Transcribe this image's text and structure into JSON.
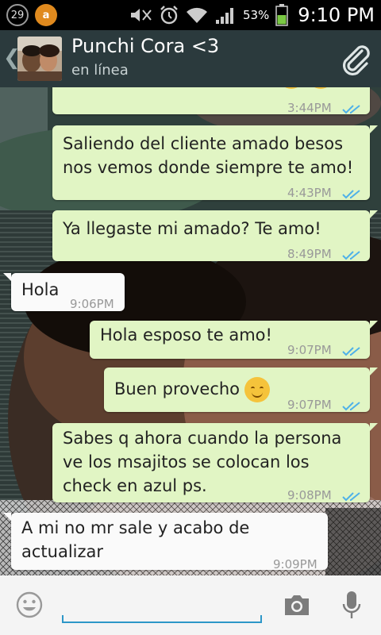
{
  "status": {
    "notif_count": "29",
    "notif_app": "a",
    "battery": "53%",
    "time": "9:10 PM"
  },
  "contact": {
    "name": "Punchi Cora <3",
    "status": "en línea"
  },
  "messages": [
    {
      "text": "",
      "time": "3:44PM"
    },
    {
      "text": "Saliendo del cliente amado besos\nnos vemos donde siempre te amo!",
      "time": "4:43PM"
    },
    {
      "text": "Ya llegaste mi amado? Te amo!",
      "time": "8:49PM"
    },
    {
      "text": "Hola",
      "time": "9:06PM"
    },
    {
      "text": "Hola esposo te amo!",
      "time": "9:07PM"
    },
    {
      "text": "Buen provecho",
      "time": "9:07PM"
    },
    {
      "text": "Sabes q ahora cuando la persona\nve los msajitos se colocan los\ncheck en azul ps.",
      "time": "9:08PM"
    },
    {
      "text": "A mi no mr sale y acabo de\nactualizar",
      "time": "9:09PM"
    }
  ],
  "input": {
    "placeholder": ""
  },
  "colors": {
    "outgoing": "#e1f5c4",
    "incoming": "#fafafa",
    "tick_blue": "#4fb1e8",
    "action_bar": "#2b3a3d",
    "input_underline": "#2d97c8"
  }
}
